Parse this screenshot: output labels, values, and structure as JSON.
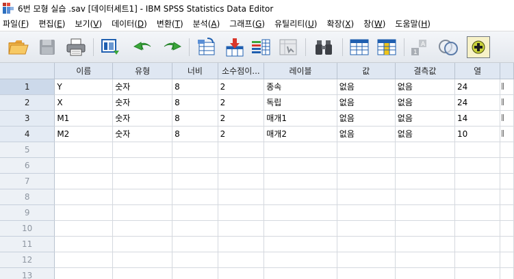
{
  "window": {
    "title": "6번 모형 실습 .sav [데이터세트1] - IBM SPSS Statistics Data Editor"
  },
  "menu": [
    {
      "label": "파일(F)",
      "base": "파일(",
      "key": "F",
      "tail": ")"
    },
    {
      "label": "편집(E)",
      "base": "편집(",
      "key": "E",
      "tail": ")"
    },
    {
      "label": "보기(V)",
      "base": "보기(",
      "key": "V",
      "tail": ")"
    },
    {
      "label": "데이터(D)",
      "base": "데이터(",
      "key": "D",
      "tail": ")"
    },
    {
      "label": "변환(T)",
      "base": "변환(",
      "key": "T",
      "tail": ")"
    },
    {
      "label": "분석(A)",
      "base": "분석(",
      "key": "A",
      "tail": ")"
    },
    {
      "label": "그래프(G)",
      "base": "그래프(",
      "key": "G",
      "tail": ")"
    },
    {
      "label": "유틸리티(U)",
      "base": "유틸리티(",
      "key": "U",
      "tail": ")"
    },
    {
      "label": "확장(X)",
      "base": "확장(",
      "key": "X",
      "tail": ")"
    },
    {
      "label": "창(W)",
      "base": "창(",
      "key": "W",
      "tail": ")"
    },
    {
      "label": "도움말(H)",
      "base": "도움말(",
      "key": "H",
      "tail": ")"
    }
  ],
  "toolbar": [
    {
      "name": "open-folder-icon"
    },
    {
      "name": "save-icon"
    },
    {
      "name": "print-icon"
    },
    {
      "name": "recall-dialog-icon"
    },
    {
      "name": "undo-icon"
    },
    {
      "name": "redo-icon"
    },
    {
      "name": "goto-case-icon"
    },
    {
      "name": "goto-variable-icon"
    },
    {
      "name": "variables-icon"
    },
    {
      "name": "run-descriptives-icon"
    },
    {
      "name": "find-icon"
    },
    {
      "name": "insert-cases-icon"
    },
    {
      "name": "insert-variable-icon"
    },
    {
      "name": "split-file-icon"
    },
    {
      "name": "value-labels-icon"
    },
    {
      "name": "use-sets-icon"
    }
  ],
  "grid": {
    "columns": [
      "이름",
      "유형",
      "너비",
      "소수점이...",
      "레이블",
      "값",
      "결측값",
      "열"
    ],
    "rows": [
      {
        "num": "1",
        "cells": [
          "Y",
          "숫자",
          "8",
          "2",
          "종속",
          "없음",
          "없음",
          "24"
        ]
      },
      {
        "num": "2",
        "cells": [
          "X",
          "숫자",
          "8",
          "2",
          "독립",
          "없음",
          "없음",
          "24"
        ]
      },
      {
        "num": "3",
        "cells": [
          "M1",
          "숫자",
          "8",
          "2",
          "매개1",
          "없음",
          "없음",
          "14"
        ]
      },
      {
        "num": "4",
        "cells": [
          "M2",
          "숫자",
          "8",
          "2",
          "매개2",
          "없음",
          "없음",
          "10"
        ]
      },
      {
        "num": "5",
        "cells": [
          "",
          "",
          "",
          "",
          "",
          "",
          "",
          ""
        ]
      },
      {
        "num": "6",
        "cells": [
          "",
          "",
          "",
          "",
          "",
          "",
          "",
          ""
        ]
      },
      {
        "num": "7",
        "cells": [
          "",
          "",
          "",
          "",
          "",
          "",
          "",
          ""
        ]
      },
      {
        "num": "8",
        "cells": [
          "",
          "",
          "",
          "",
          "",
          "",
          "",
          ""
        ]
      },
      {
        "num": "9",
        "cells": [
          "",
          "",
          "",
          "",
          "",
          "",
          "",
          ""
        ]
      },
      {
        "num": "10",
        "cells": [
          "",
          "",
          "",
          "",
          "",
          "",
          "",
          ""
        ]
      },
      {
        "num": "11",
        "cells": [
          "",
          "",
          "",
          "",
          "",
          "",
          "",
          ""
        ]
      },
      {
        "num": "12",
        "cells": [
          "",
          "",
          "",
          "",
          "",
          "",
          "",
          ""
        ]
      },
      {
        "num": "13",
        "cells": [
          "",
          "",
          "",
          "",
          "",
          "",
          "",
          ""
        ]
      }
    ]
  },
  "colors": {
    "header_bg": "#dfe7f2",
    "row_header_bg": "#e4ebf4",
    "grid_line": "#d4d8de",
    "toolbar_accent_green": "#3aa63a",
    "toolbar_accent_red": "#d9362b",
    "toolbar_accent_blue": "#1f5fb0"
  }
}
